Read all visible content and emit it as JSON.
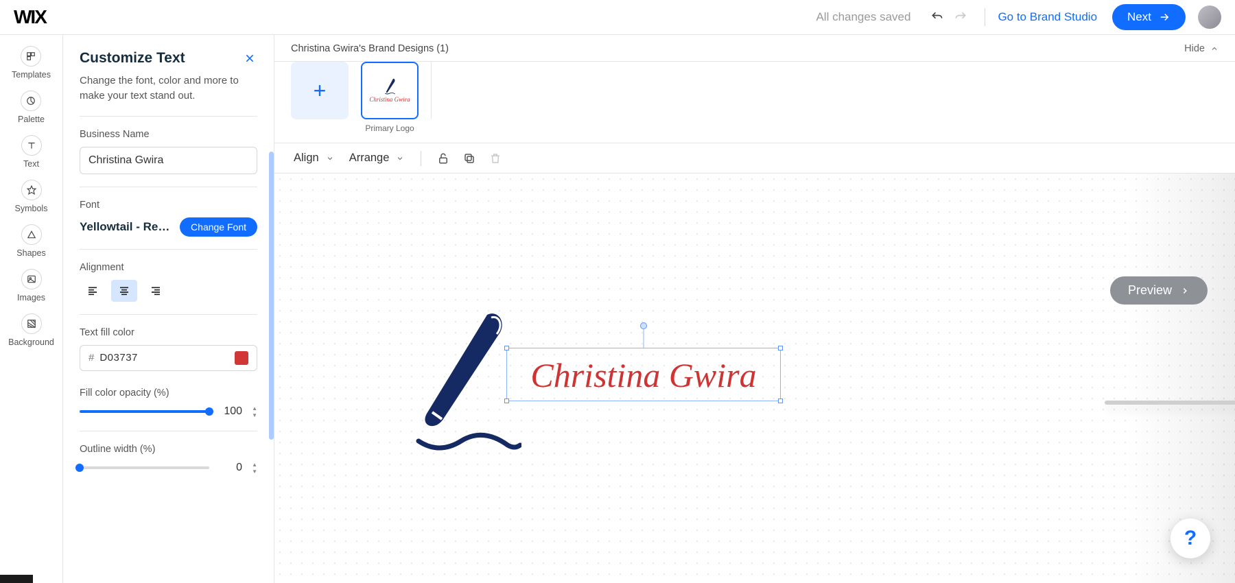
{
  "topbar": {
    "logo": "WIX",
    "save_state": "All changes saved",
    "brand_studio": "Go to Brand Studio",
    "next": "Next"
  },
  "rail": [
    {
      "label": "Templates",
      "icon": "templates"
    },
    {
      "label": "Palette",
      "icon": "palette"
    },
    {
      "label": "Text",
      "icon": "text"
    },
    {
      "label": "Symbols",
      "icon": "star"
    },
    {
      "label": "Shapes",
      "icon": "shapes"
    },
    {
      "label": "Images",
      "icon": "images"
    },
    {
      "label": "Background",
      "icon": "background"
    }
  ],
  "panel": {
    "title": "Customize Text",
    "desc": "Change the font, color and more to make your text stand out.",
    "business_label": "Business Name",
    "business_value": "Christina Gwira",
    "font_label": "Font",
    "font_value": "Yellowtail - Reg…",
    "change_font": "Change Font",
    "alignment_label": "Alignment",
    "alignment_active": "center",
    "fill_label": "Text fill color",
    "fill_hex": "D03737",
    "opacity_label": "Fill color opacity (%)",
    "opacity_value": "100",
    "outline_label": "Outline width (%)",
    "outline_value": "0"
  },
  "canvas": {
    "brand_title": "Christina Gwira's Brand Designs (1)",
    "hide": "Hide",
    "primary_caption": "Primary Logo",
    "align_dd": "Align",
    "arrange_dd": "Arrange",
    "preview": "Preview",
    "text_value": "Christina Gwira",
    "text_color": "#cf3434",
    "pen_color": "#152a62"
  },
  "help": "?"
}
